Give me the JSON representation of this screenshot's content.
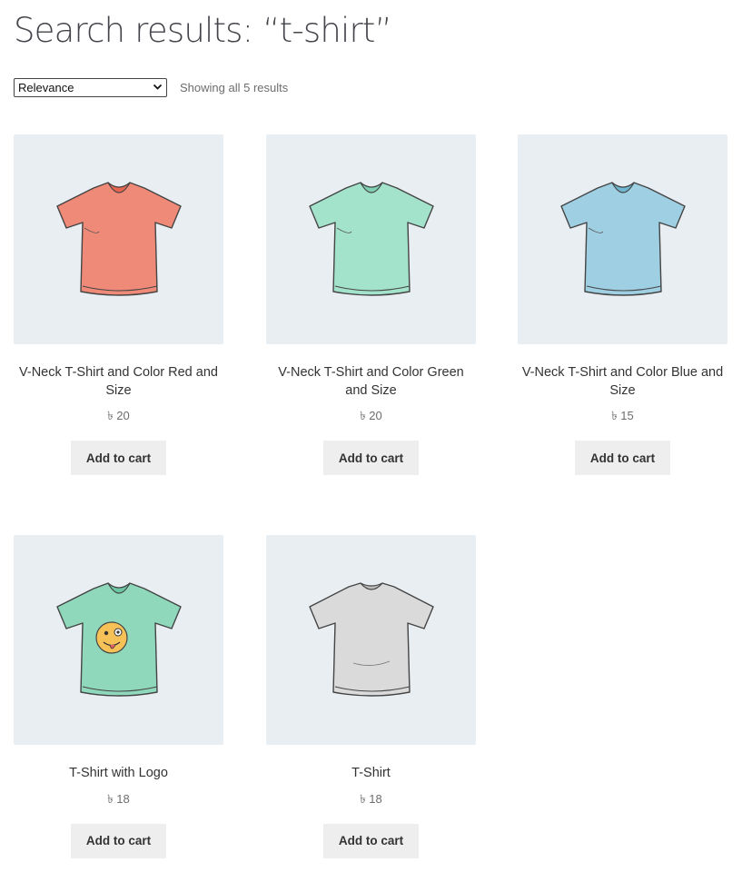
{
  "page": {
    "title": "Search results: “t-shirt”"
  },
  "toolbar": {
    "ordering_selected": "Relevance",
    "result_count": "Showing all 5 results"
  },
  "products": [
    {
      "name": "V-Neck T-Shirt and Color Red and Size",
      "price": "৳ 20",
      "button": "Add to cart",
      "color": "#f08a78",
      "icon": "tshirt-vneck-red-icon"
    },
    {
      "name": "V-Neck T-Shirt and Color Green and Size",
      "price": "৳ 20",
      "button": "Add to cart",
      "color": "#9fe0c8",
      "icon": "tshirt-vneck-green-icon"
    },
    {
      "name": "V-Neck T-Shirt and Color Blue and Size",
      "price": "৳ 15",
      "button": "Add to cart",
      "color": "#9fcfe2",
      "icon": "tshirt-vneck-blue-icon"
    },
    {
      "name": "T-Shirt with Logo",
      "price": "৳ 18",
      "button": "Add to cart",
      "color": "#8fd8bc",
      "icon": "tshirt-logo-icon"
    },
    {
      "name": "T-Shirt",
      "price": "৳ 18",
      "button": "Add to cart",
      "color": "#d8d8d8",
      "icon": "tshirt-grey-icon"
    }
  ]
}
